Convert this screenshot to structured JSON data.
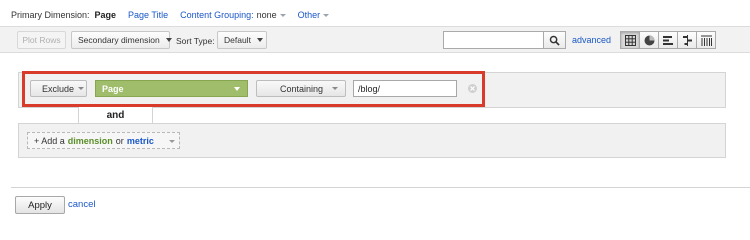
{
  "dimension_bar": {
    "label": "Primary Dimension:",
    "current": "Page",
    "page_title_link": "Page Title",
    "content_grouping_label": "Content Grouping:",
    "content_grouping_value": "none",
    "other_link": "Other"
  },
  "toolbar": {
    "plot_rows": "Plot Rows",
    "secondary_dimension": "Secondary dimension",
    "sort_type_label": "Sort Type:",
    "sort_type_value": "Default",
    "search_value": "",
    "advanced_link": "advanced",
    "view_icons": [
      "table-view-icon",
      "pie-view-icon",
      "performance-view-icon",
      "comparison-view-icon",
      "pivot-view-icon"
    ],
    "active_view": "table-view-icon"
  },
  "filter": {
    "mode": "Exclude",
    "dimension": "Page",
    "match_type": "Containing",
    "value": "/blog/"
  },
  "connector": "and",
  "add_condition": {
    "prefix": "+ Add a",
    "dimension_word": "dimension",
    "or_word": "or",
    "metric_word": "metric"
  },
  "footer": {
    "apply": "Apply",
    "cancel": "cancel"
  },
  "colors": {
    "link": "#1a58c7",
    "dimension_green": "#9fbd6a",
    "highlight_red": "#d93b2b",
    "panel_gray": "#f1f1f1"
  }
}
